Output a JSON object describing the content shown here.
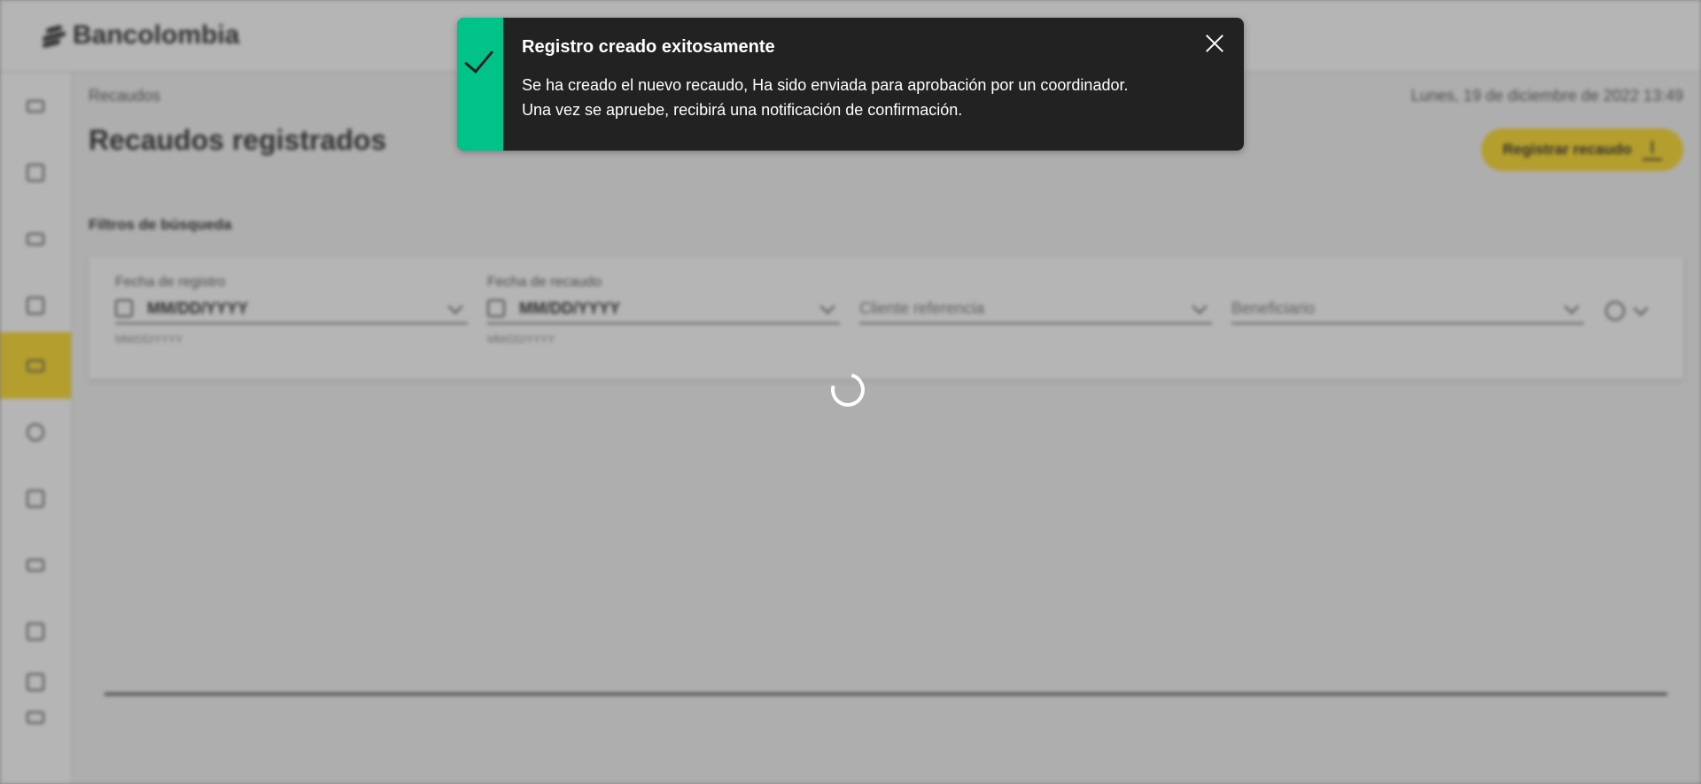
{
  "brand": {
    "name": "Bancolombia"
  },
  "breadcrumb": "Recaudos",
  "datetime": "Lunes, 19 de diciembre de 2022 13:49",
  "page_title": "Recaudos registrados",
  "register_button": {
    "label": "Registrar recaudo",
    "icon": "upload-icon"
  },
  "filters": {
    "label": "Filtros de búsqueda",
    "registro": {
      "label": "Fecha de registro",
      "value": "MM/DD/YYYY",
      "help": "MM/DD/YYYY"
    },
    "recaudo": {
      "label": "Fecha de recaudo",
      "value": "MM/DD/YYYY",
      "help": "MM/DD/YYYY"
    },
    "cliente": {
      "placeholder": "Cliente referencia"
    },
    "beneficiario": {
      "placeholder": "Beneficiario"
    }
  },
  "sidebar": {
    "items": [
      {
        "icon": "filter-icon"
      },
      {
        "icon": "document-icon"
      },
      {
        "icon": "money-icon"
      },
      {
        "icon": "documents-icon"
      },
      {
        "icon": "transfer-icon",
        "active": true
      },
      {
        "icon": "settings-icon"
      },
      {
        "icon": "file-icon"
      },
      {
        "icon": "barcode-icon"
      },
      {
        "icon": "report-icon"
      },
      {
        "icon": "users-icon"
      },
      {
        "icon": "logout-icon"
      }
    ]
  },
  "toast": {
    "title": "Registro creado exitosamente",
    "line1": "Se ha creado el nuevo recaudo, Ha sido enviada para aprobación por un coordinador.",
    "line2": "Una vez se apruebe, recibirá una notificación de confirmación.",
    "accent_color": "#00c389"
  },
  "colors": {
    "brand_yellow": "#fdda24",
    "success": "#00c389",
    "toast_bg": "#222222"
  }
}
